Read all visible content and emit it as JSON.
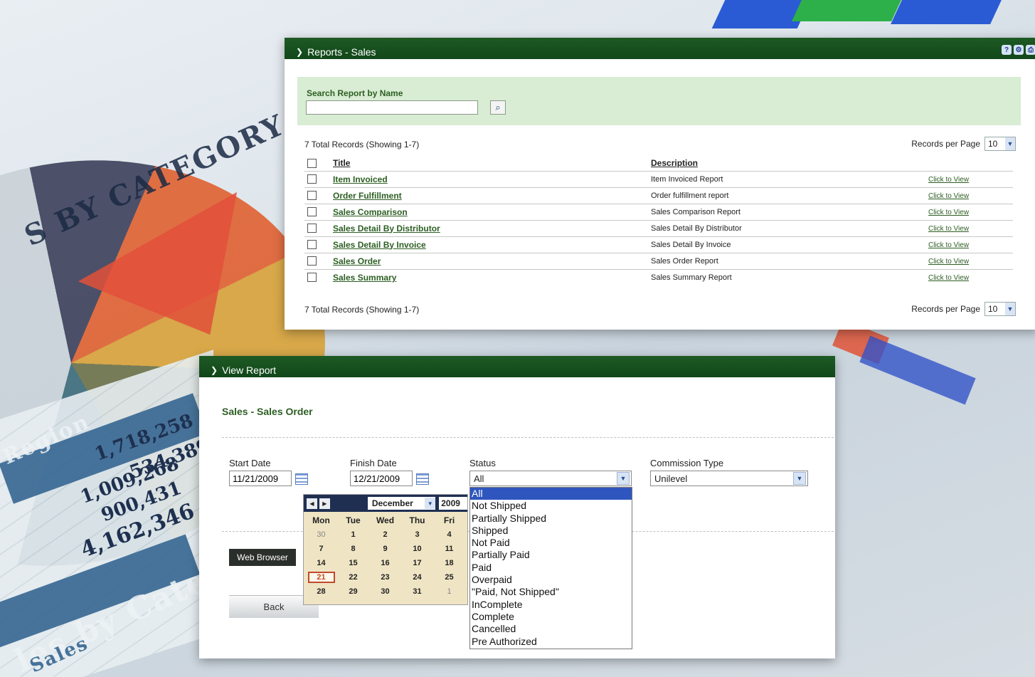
{
  "reports_panel": {
    "title": "Reports - Sales",
    "search_label": "Search Report by Name",
    "search_value": "",
    "total_records_top": "7 Total Records (Showing 1-7)",
    "total_records_bottom": "7 Total Records (Showing 1-7)",
    "rpp_label": "Records per Page",
    "rpp_value": "10",
    "columns": {
      "title": "Title",
      "description": "Description"
    },
    "rows": [
      {
        "title": "Item Invoiced",
        "description": "Item Invoiced Report",
        "link": "Click to View"
      },
      {
        "title": "Order Fulfillment",
        "description": "Order fulfillment report",
        "link": "Click to View"
      },
      {
        "title": "Sales Comparison",
        "description": "Sales Comparison Report",
        "link": "Click to View"
      },
      {
        "title": "Sales Detail By Distributor",
        "description": "Sales Detail By Distributor",
        "link": "Click to View"
      },
      {
        "title": "Sales Detail By Invoice",
        "description": "Sales Detail By Invoice",
        "link": "Click to View"
      },
      {
        "title": "Sales Order",
        "description": "Sales Order Report",
        "link": "Click to View"
      },
      {
        "title": "Sales Summary",
        "description": "Sales Summary Report",
        "link": "Click to View"
      }
    ],
    "icons": [
      "help-icon",
      "settings-icon",
      "print-icon"
    ]
  },
  "view_panel": {
    "title": "View Report",
    "subtitle": "Sales - Sales Order",
    "start_date_label": "Start Date",
    "start_date": "11/21/2009",
    "finish_date_label": "Finish Date",
    "finish_date": "12/21/2009",
    "status_label": "Status",
    "status_value": "All",
    "commission_label": "Commission Type",
    "commission_value": "Unilevel",
    "web_browser_button": "Web Browser",
    "back_button": "Back"
  },
  "calendar": {
    "month": "December",
    "year": "2009",
    "weekdays": [
      "Mon",
      "Tue",
      "Wed",
      "Thu",
      "Fri"
    ],
    "weeks": [
      [
        "30",
        "1",
        "2",
        "3",
        "4"
      ],
      [
        "7",
        "8",
        "9",
        "10",
        "11"
      ],
      [
        "14",
        "15",
        "16",
        "17",
        "18"
      ],
      [
        "21",
        "22",
        "23",
        "24",
        "25"
      ],
      [
        "28",
        "29",
        "30",
        "31",
        "1"
      ]
    ],
    "today": "21"
  },
  "status_options": [
    "All",
    "Not Shipped",
    "Partially Shipped",
    "Shipped",
    "Not Paid",
    "Partially Paid",
    "Paid",
    "Overpaid",
    "\"Paid, Not Shipped\"",
    "InComplete",
    "Complete",
    "Cancelled",
    "Pre Authorized"
  ],
  "background_text": {
    "category": "S BY CATEGORY",
    "region": "Region",
    "values": [
      "1,718,258",
      "534,389",
      "1,009,268",
      "900,431",
      "4,162,346"
    ],
    "category2": "les by Categ",
    "sales": "Sales"
  },
  "colors": {
    "header_green": "#1e5a24",
    "search_bg": "#d9ecd4",
    "link_green": "#2c5e22",
    "list_select": "#2f56bf"
  }
}
